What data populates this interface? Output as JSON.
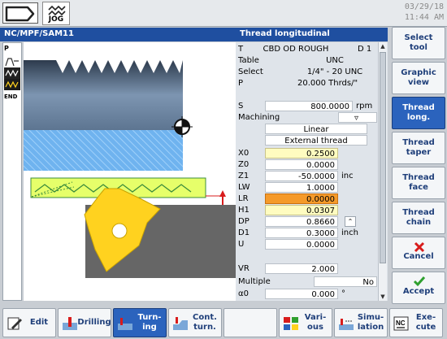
{
  "top": {
    "mode": "JOG",
    "date": "03/29/18",
    "time": "11:44 AM"
  },
  "path": "NC/MPF/SAM11",
  "form_title": "Thread longitudinal",
  "steps": [
    "P",
    "END"
  ],
  "form": {
    "rows": [
      {
        "k": "T",
        "v": "CBD OD ROUGH",
        "extra": "D 1"
      },
      {
        "k": "Table",
        "v": "UNC"
      },
      {
        "k": "Select",
        "v": "1/4\" - 20 UNC"
      },
      {
        "k": "P",
        "v": "20.000 Thrds/\""
      },
      {
        "k": "S",
        "v": "800.0000",
        "u": "rpm"
      },
      {
        "k": "Machining",
        "v": ""
      },
      {
        "k": "",
        "v": "Linear"
      },
      {
        "k": "",
        "v": "External thread"
      },
      {
        "k": "X0",
        "v": "0.2500"
      },
      {
        "k": "Z0",
        "v": "0.0000"
      },
      {
        "k": "Z1",
        "v": "-50.0000",
        "u": "inc"
      },
      {
        "k": "LW",
        "v": "1.0000"
      },
      {
        "k": "LR",
        "v": "0.0000"
      },
      {
        "k": "H1",
        "v": "0.0307"
      },
      {
        "k": "DP",
        "v": "0.8660"
      },
      {
        "k": "D1",
        "v": "0.3000",
        "u": "inch"
      },
      {
        "k": "U",
        "v": "0.0000"
      },
      {
        "k": "VR",
        "v": "2.000"
      },
      {
        "k": "Multiple",
        "v": "No"
      },
      {
        "k": "α0",
        "v": "0.000",
        "u": "°"
      }
    ]
  },
  "vsoftkeys": [
    {
      "label": "Select\ntool"
    },
    {
      "label": "Graphic\nview"
    },
    {
      "label": "Thread\nlong."
    },
    {
      "label": "Thread\ntaper"
    },
    {
      "label": "Thread\nface"
    },
    {
      "label": "Thread\nchain"
    },
    {
      "label": "Cancel"
    },
    {
      "label": "Accept"
    }
  ],
  "hsoftkeys": [
    {
      "label": "Edit"
    },
    {
      "label": "Drilling"
    },
    {
      "label": "Turn-\ning"
    },
    {
      "label": "Cont.\nturn."
    },
    {
      "label": ""
    },
    {
      "label": "Vari-\nous"
    },
    {
      "label": "Simu-\nlation"
    },
    {
      "label": "Exe-\ncute"
    }
  ],
  "colors": {
    "header": "#1f4fa0",
    "active": "#2b63bd",
    "highlight_yellow": "#fffcc0",
    "highlight_orange": "#f59a2a",
    "tool_yellow": "#ffd21f",
    "cancel_red": "#d81c1c",
    "accept_green": "#2fa02f"
  },
  "icons": [
    "back-arrow-icon",
    "jog-icon",
    "step-program-icon",
    "step-contour-icon",
    "step-thread-icon",
    "edit-icon",
    "drilling-icon",
    "turning-icon",
    "contour-turning-icon",
    "various-icon",
    "simulation-icon",
    "execute-nc-icon",
    "cancel-x-icon",
    "accept-check-icon"
  ]
}
